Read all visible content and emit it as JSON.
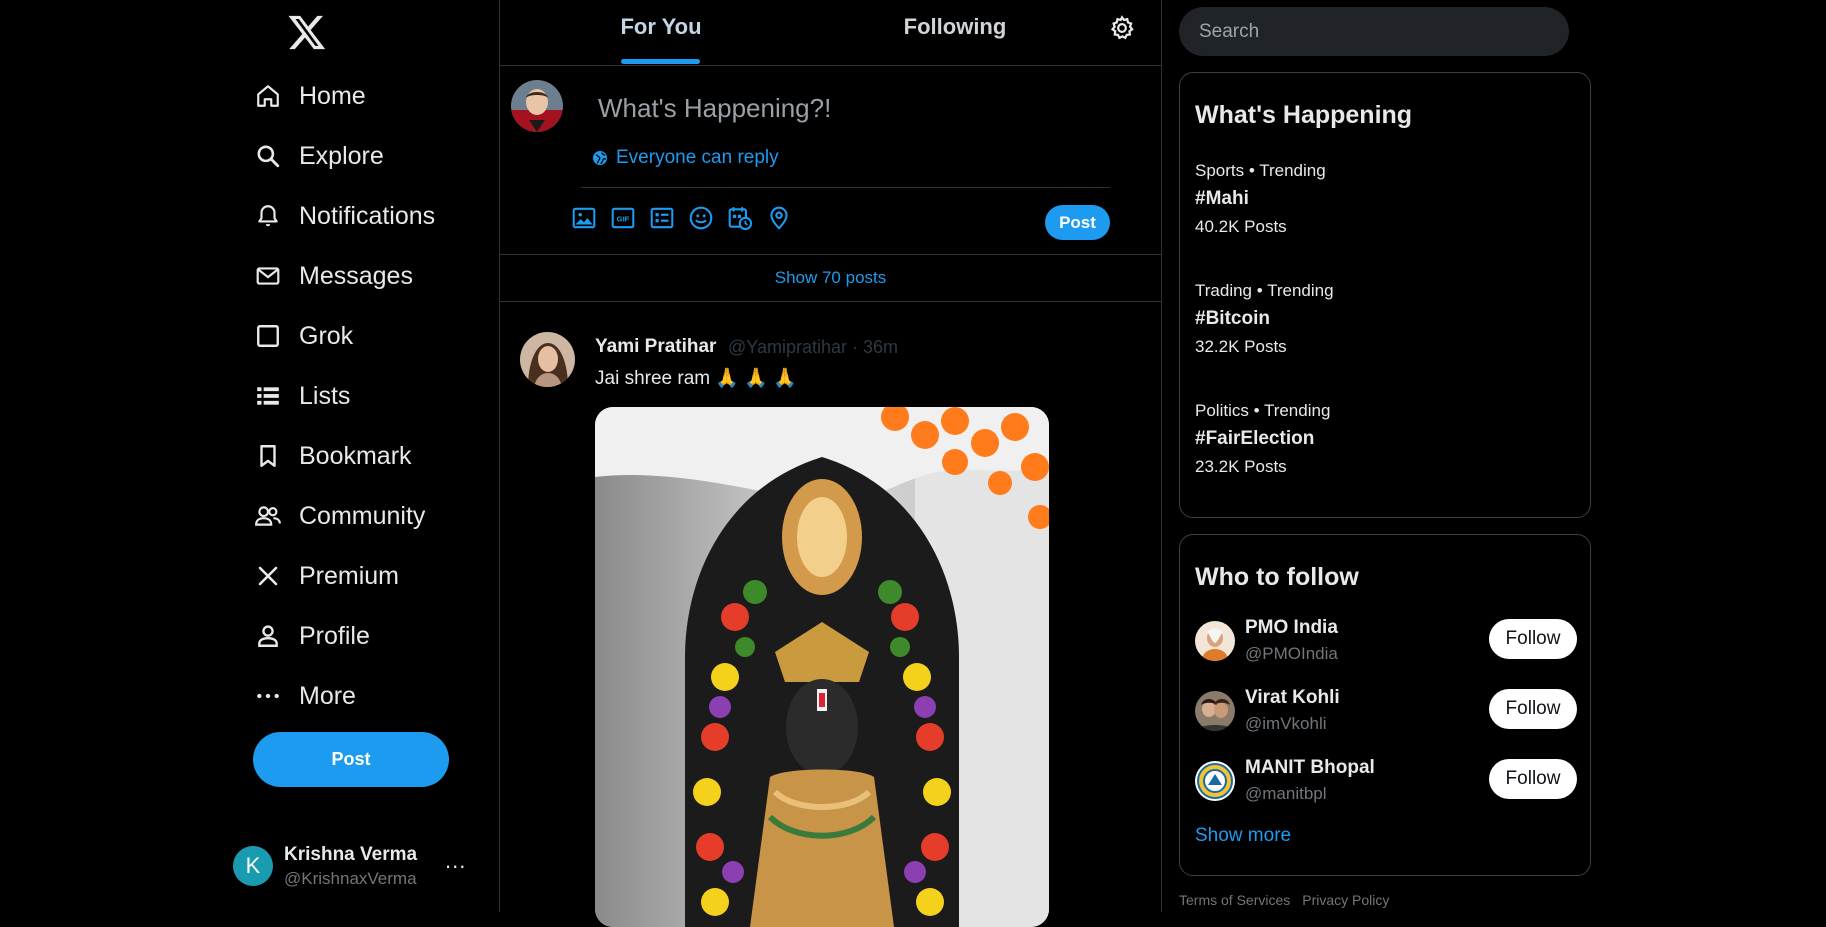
{
  "sidebar": {
    "logo": "x-logo",
    "items": [
      {
        "label": "Home",
        "icon": "home-icon"
      },
      {
        "label": "Explore",
        "icon": "search-icon"
      },
      {
        "label": "Notifications",
        "icon": "bell-icon"
      },
      {
        "label": "Messages",
        "icon": "mail-icon"
      },
      {
        "label": "Grok",
        "icon": "grok-icon"
      },
      {
        "label": "Lists",
        "icon": "list-icon"
      },
      {
        "label": "Bookmark",
        "icon": "bookmark-icon"
      },
      {
        "label": "Community",
        "icon": "people-icon"
      },
      {
        "label": "Premium",
        "icon": "x-icon"
      },
      {
        "label": "Profile",
        "icon": "person-icon"
      },
      {
        "label": "More",
        "icon": "more-icon"
      }
    ],
    "post_label": "Post",
    "account": {
      "initial": "K",
      "name": "Krishna Verma",
      "handle": "@KrishnaxVerma",
      "more": "..."
    }
  },
  "center": {
    "tabs": [
      {
        "label": "For You",
        "active": true
      },
      {
        "label": "Following",
        "active": false
      }
    ],
    "composer": {
      "placeholder": "What's Happening?!",
      "reply_setting": "Everyone can reply",
      "tools": [
        "image-icon",
        "gif-icon",
        "poll-icon",
        "emoji-icon",
        "schedule-icon",
        "location-icon"
      ],
      "post_label": "Post"
    },
    "show_posts": "Show 70 posts",
    "tweet": {
      "name": "Yami Pratihar",
      "meta": "@Yamipratihar · 36m",
      "text": "Jai shree ram 🙏 🙏 🙏"
    }
  },
  "right": {
    "search_placeholder": "Search",
    "trends": {
      "title": "What's Happening",
      "items": [
        {
          "category": "Sports • Trending",
          "tag": "#Mahi",
          "count": "40.2K Posts"
        },
        {
          "category": "Trading • Trending",
          "tag": "#Bitcoin",
          "count": "32.2K Posts"
        },
        {
          "category": "Politics • Trending",
          "tag": "#FairElection",
          "count": "23.2K Posts"
        }
      ]
    },
    "who_to_follow": {
      "title": "Who to follow",
      "items": [
        {
          "name": "PMO India",
          "handle": "@PMOIndia",
          "button": "Follow"
        },
        {
          "name": "Virat Kohli",
          "handle": "@imVkohli",
          "button": "Follow"
        },
        {
          "name": "MANIT Bhopal",
          "handle": "@manitbpl",
          "button": "Follow"
        }
      ],
      "show_more": "Show more"
    },
    "footer": [
      "Terms of Services",
      "Privacy Policy"
    ]
  },
  "colors": {
    "accent": "#1d9bf0",
    "background": "#000000",
    "border": "#2f3336"
  }
}
